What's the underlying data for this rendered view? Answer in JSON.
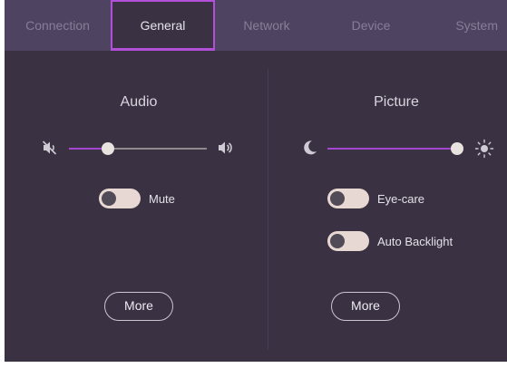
{
  "tabs": [
    {
      "label": "Connection"
    },
    {
      "label": "General"
    },
    {
      "label": "Network"
    },
    {
      "label": "Device"
    },
    {
      "label": "System"
    }
  ],
  "active_tab": "General",
  "audio": {
    "title": "Audio",
    "mute_icon": "volume-mute-icon",
    "loud_icon": "volume-up-icon",
    "volume_level": 0.28,
    "mute_label": "Mute",
    "mute_on": false,
    "more_label": "More"
  },
  "picture": {
    "title": "Picture",
    "dim_icon": "moon-icon",
    "bright_icon": "sun-icon",
    "brightness_level": 0.98,
    "eyecare_label": "Eye-care",
    "eyecare_on": false,
    "backlight_label": "Auto Backlight",
    "backlight_on": false,
    "more_label": "More"
  },
  "colors": {
    "background": "#3a3142",
    "tabbar": "#4e4461",
    "accent": "#a546d2",
    "active_border": "#b24fd8"
  }
}
